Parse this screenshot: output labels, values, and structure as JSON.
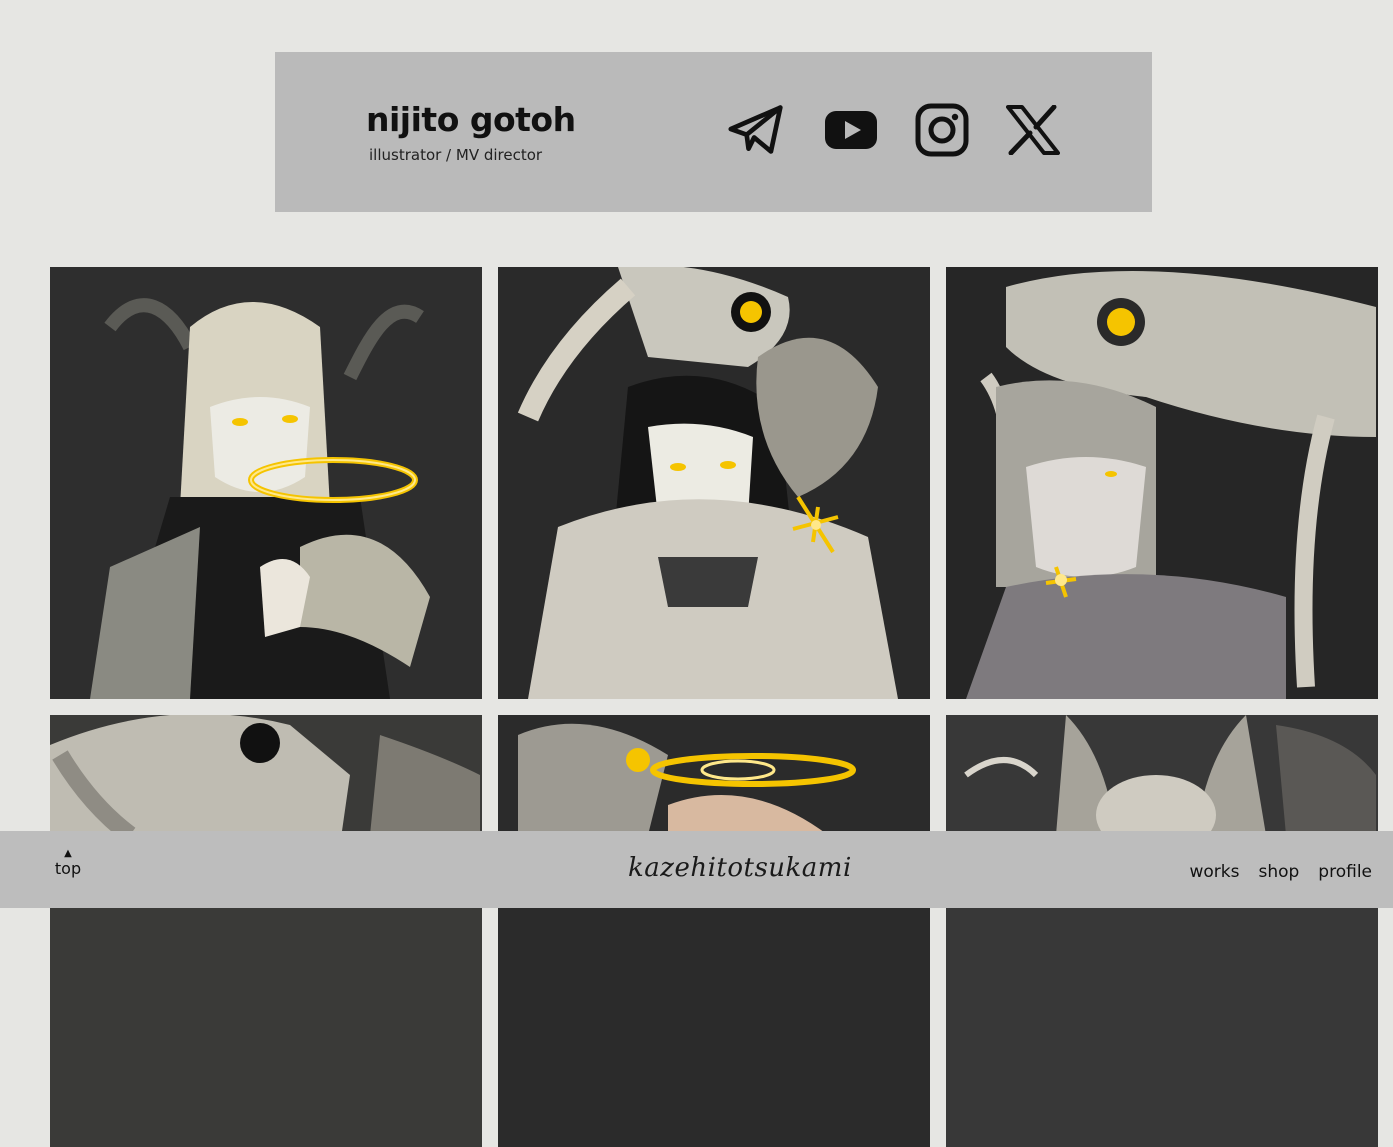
{
  "header": {
    "name": "nijito gotoh",
    "role": "illustrator / MV director"
  },
  "social": [
    {
      "icon": "telegram-icon",
      "label": "Telegram"
    },
    {
      "icon": "youtube-icon",
      "label": "YouTube"
    },
    {
      "icon": "instagram-icon",
      "label": "Instagram"
    },
    {
      "icon": "x-icon",
      "label": "X"
    }
  ],
  "gallery": {
    "items": [
      {
        "subject": "antlered figure with golden halo"
      },
      {
        "subject": "woman with raised hand and glowing star"
      },
      {
        "subject": "girl beneath beast with glowing eye"
      },
      {
        "subject": "horned skull"
      },
      {
        "subject": "skull with golden halo"
      },
      {
        "subject": "insect wings"
      }
    ],
    "accent": "#f5c400"
  },
  "footer": {
    "top_label": "top",
    "top_arrow": "▲",
    "logo": "kazehitotsukami",
    "nav": [
      "works",
      "shop",
      "profile"
    ]
  },
  "colors": {
    "page_bg": "#e6e6e3",
    "header_bg": "#bababa",
    "footer_bg": "#bdbdbd"
  }
}
